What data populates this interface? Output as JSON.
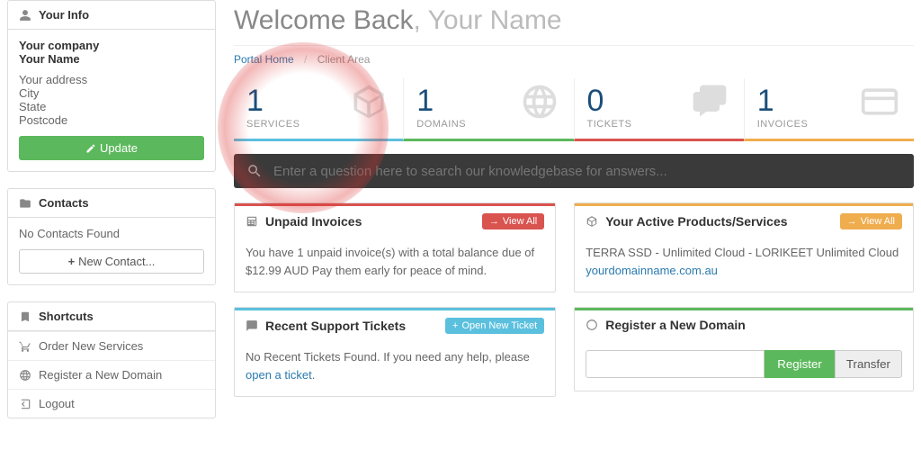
{
  "sidebar": {
    "your_info_title": "Your Info",
    "company": "Your company",
    "name": "Your Name",
    "address": "Your address",
    "city": "City",
    "state": "State",
    "postcode": "Postcode",
    "update_btn": "Update",
    "contacts_title": "Contacts",
    "no_contacts": "No Contacts Found",
    "new_contact_btn": "New Contact...",
    "shortcuts_title": "Shortcuts",
    "shortcuts": {
      "order": "Order New Services",
      "register": "Register a New Domain",
      "logout": "Logout"
    }
  },
  "header": {
    "welcome_prefix": "Welcome Back",
    "welcome_name": ", Your Name",
    "crumb_home": "Portal Home",
    "crumb_area": "Client Area"
  },
  "stats": {
    "services": {
      "value": "1",
      "label": "SERVICES"
    },
    "domains": {
      "value": "1",
      "label": "DOMAINS"
    },
    "tickets": {
      "value": "0",
      "label": "TICKETS"
    },
    "invoices": {
      "value": "1",
      "label": "INVOICES"
    }
  },
  "search": {
    "placeholder": "Enter a question here to search our knowledgebase for answers..."
  },
  "unpaid": {
    "title": "Unpaid Invoices",
    "view_all": "View All",
    "line1": "You have 1 unpaid invoice(s) with a total balance due of ",
    "amount": "$12.99 AUD",
    "line2": " Pay them early for peace of mind."
  },
  "active": {
    "title": "Your Active Products/Services",
    "view_all": "View All",
    "product": "TERRA SSD - Unlimited Cloud - LORIKEET Unlimited Cloud",
    "domain": "yourdomainname.com.au"
  },
  "tickets": {
    "title": "Recent Support Tickets",
    "open_btn": "Open New Ticket",
    "none": "No Recent Tickets Found. ",
    "help": "If you need any help, please ",
    "link": "open a ticket"
  },
  "register": {
    "title": "Register a New Domain",
    "reg_btn": "Register",
    "tr_btn": "Transfer"
  }
}
